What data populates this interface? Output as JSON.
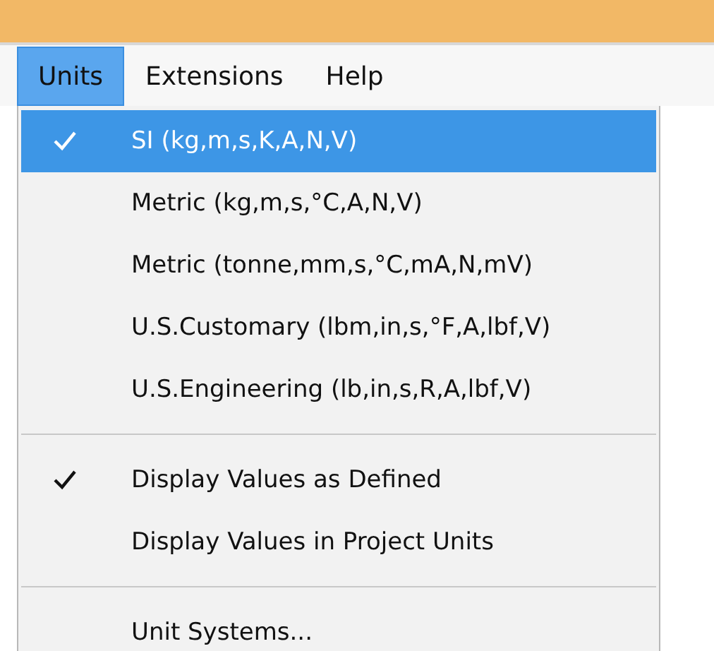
{
  "menubar": [
    {
      "label": "Units",
      "selected": true
    },
    {
      "label": "Extensions",
      "selected": false
    },
    {
      "label": "Help",
      "selected": false
    }
  ],
  "menu": [
    {
      "kind": "item",
      "label": "SI (kg,m,s,K,A,N,V)",
      "checked": true,
      "selected": true
    },
    {
      "kind": "item",
      "label": "Metric (kg,m,s,°C,A,N,V)",
      "checked": false,
      "selected": false
    },
    {
      "kind": "item",
      "label": "Metric (tonne,mm,s,°C,mA,N,mV)",
      "checked": false,
      "selected": false
    },
    {
      "kind": "item",
      "label": "U.S.Customary (lbm,in,s,°F,A,lbf,V)",
      "checked": false,
      "selected": false
    },
    {
      "kind": "item",
      "label": "U.S.Engineering (lb,in,s,R,A,lbf,V)",
      "checked": false,
      "selected": false
    },
    {
      "kind": "separator"
    },
    {
      "kind": "item",
      "label": "Display Values as Defined",
      "checked": true,
      "selected": false
    },
    {
      "kind": "item",
      "label": "Display Values in Project Units",
      "checked": false,
      "selected": false
    },
    {
      "kind": "separator"
    },
    {
      "kind": "item",
      "label": "Unit Systems...",
      "checked": false,
      "selected": false
    }
  ]
}
